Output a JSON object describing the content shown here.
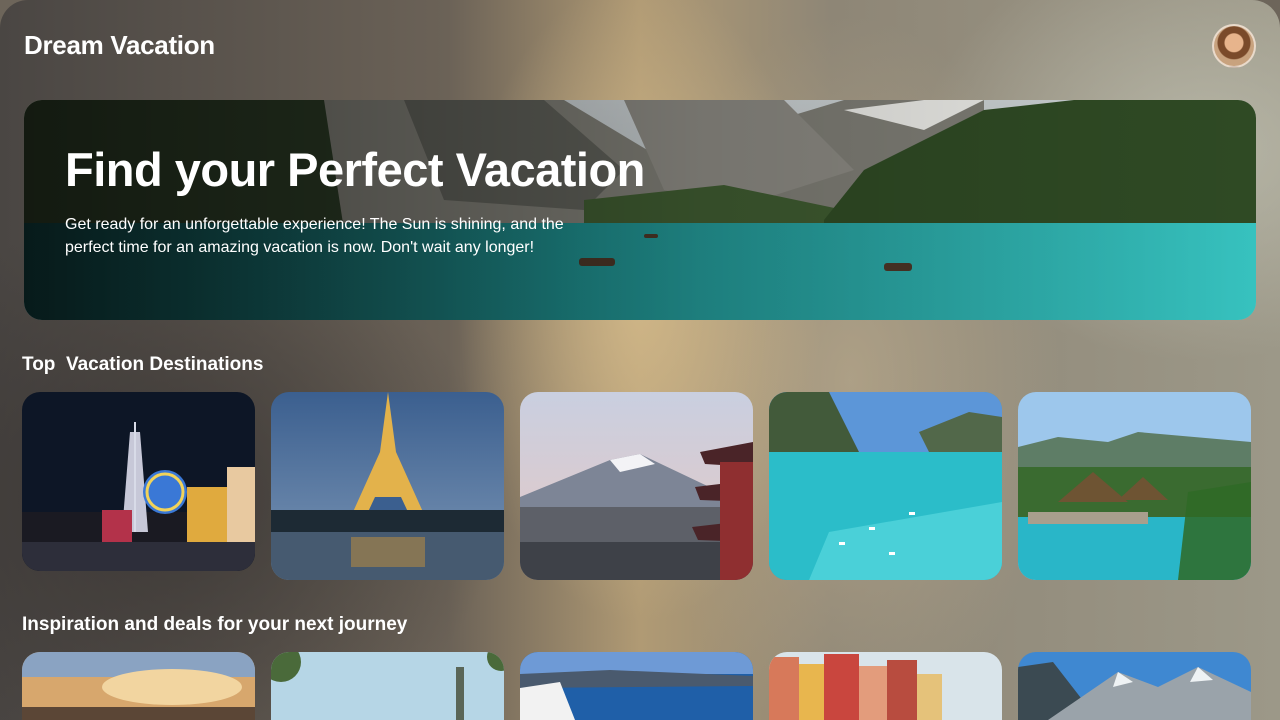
{
  "app": {
    "title": "Dream Vacation"
  },
  "header": {
    "avatar": "user-avatar"
  },
  "hero": {
    "title": "Find your Perfect Vacation",
    "text": "Get ready for an unforgettable experience! The Sun is shining, and the perfect time for an amazing vacation is now. Don't wait any longer!",
    "image": "alpine-lake-photo"
  },
  "sections": {
    "top_destinations": {
      "title": "Top  Vacation Destinations",
      "cards": [
        {
          "image": "las-vegas-night-photo"
        },
        {
          "image": "eiffel-tower-photo"
        },
        {
          "image": "mount-fuji-pagoda-photo"
        },
        {
          "image": "tropical-bay-boats-photo"
        },
        {
          "image": "resort-pool-palms-photo"
        }
      ]
    },
    "inspiration": {
      "title": "Inspiration and deals for your next journey",
      "cards": [
        {
          "image": "sunset-clouds-photo"
        },
        {
          "image": "palm-tower-photo"
        },
        {
          "image": "santorini-sea-photo"
        },
        {
          "image": "cinque-terre-houses-photo"
        },
        {
          "image": "mountain-peaks-photo"
        }
      ]
    }
  },
  "colors": {
    "text": "#ffffff",
    "lake": "#2fb3b0",
    "forest": "#2f4a24"
  }
}
